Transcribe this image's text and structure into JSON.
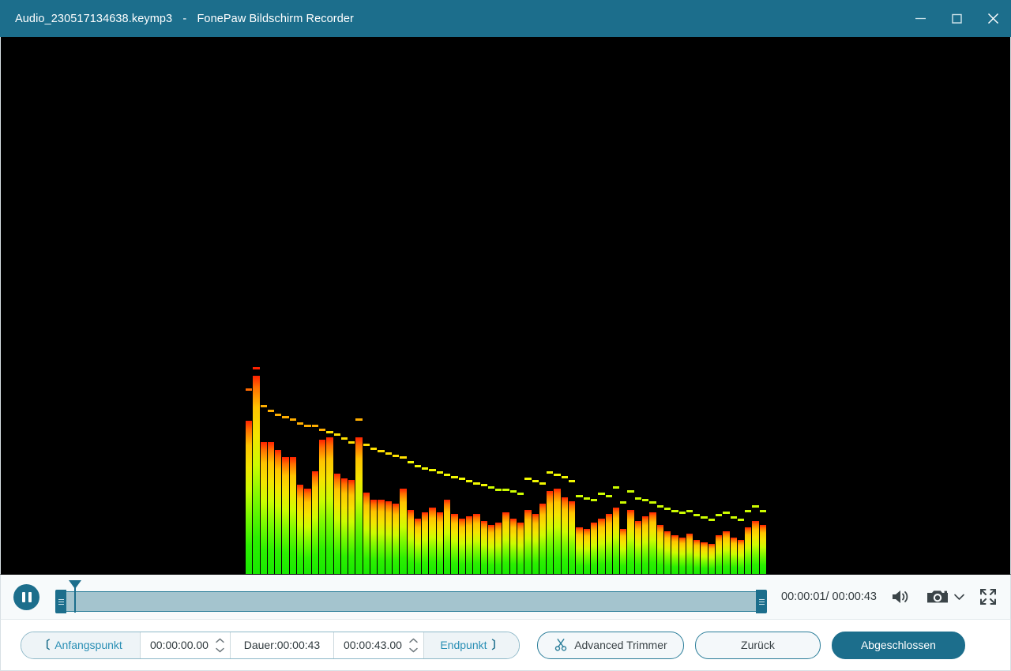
{
  "window": {
    "file_name": "Audio_230517134638.keymp3",
    "separator": "-",
    "app_name": "FonePaw Bildschirm Recorder",
    "title_bar_color": "#1c6e8c",
    "controls": {
      "minimize": "minimize-icon",
      "maximize": "maximize-icon",
      "close": "close-icon"
    }
  },
  "player": {
    "play_state_icon": "pause-icon",
    "current_time": "00:00:01",
    "total_time": "00:00:43",
    "time_display": "00:00:01/ 00:00:43",
    "volume_icon": "volume-icon",
    "snapshot_icon": "camera-icon",
    "snapshot_menu_icon": "chevron-down-icon",
    "fullscreen_icon": "fullscreen-icon",
    "slider": {
      "playhead_percent": 2.8,
      "range_start_percent": 0,
      "range_end_percent": 100,
      "track_color": "#a4c4ce",
      "handle_color": "#1c6e8c"
    }
  },
  "trim_toolbar": {
    "start_point_label": "Anfangspunkt",
    "start_point_bracket_left": "〔",
    "start_value": "00:00:00.00",
    "duration_label": "Dauer:00:00:43",
    "end_value": "00:00:43.00",
    "end_point_label": "Endpunkt",
    "end_point_bracket_right": "〕",
    "advanced_trimmer_label": "Advanced Trimmer",
    "advanced_trimmer_icon": "scissors-icon",
    "back_label": "Zurück",
    "done_label": "Abgeschlossen",
    "accent_color": "#1c6e8c",
    "link_color": "#2a8fb5"
  },
  "chart_data": {
    "type": "bar",
    "title": "Audio spectrum analyzer",
    "xlabel": "",
    "ylabel": "",
    "ylim": [
      0,
      100
    ],
    "grid": false,
    "legend": "none",
    "background": "#000000",
    "bar_gradient": [
      "#18e800",
      "#cdfc00",
      "#ffc400",
      "#ff2200"
    ],
    "note": "values = bar height %, peaks = floating peak-cap height %",
    "values": [
      72,
      93,
      62,
      62,
      58,
      55,
      55,
      42,
      40,
      48,
      63,
      64,
      47,
      45,
      44,
      64,
      38,
      35,
      35,
      34,
      33,
      40,
      30,
      26,
      29,
      31,
      29,
      35,
      28,
      26,
      27,
      28,
      25,
      23,
      24,
      29,
      26,
      24,
      30,
      28,
      33,
      39,
      40,
      36,
      34,
      22,
      21,
      24,
      26,
      28,
      31,
      21,
      30,
      25,
      27,
      29,
      23,
      20,
      18,
      17,
      19,
      16,
      15,
      14,
      18,
      20,
      17,
      16,
      22,
      25,
      23
    ],
    "peaks": [
      86,
      96,
      78,
      76,
      74,
      73,
      72,
      70,
      69,
      69,
      67,
      66,
      65,
      63,
      61,
      72,
      60,
      58,
      57,
      56,
      55,
      54,
      52,
      50,
      49,
      48,
      47,
      46,
      45,
      44,
      43,
      42,
      41,
      40,
      39,
      39,
      38,
      37,
      44,
      43,
      42,
      47,
      46,
      45,
      43,
      36,
      35,
      34,
      37,
      36,
      40,
      33,
      38,
      35,
      34,
      33,
      31,
      30,
      29,
      28,
      29,
      27,
      26,
      25,
      27,
      28,
      26,
      25,
      29,
      31,
      29
    ]
  }
}
